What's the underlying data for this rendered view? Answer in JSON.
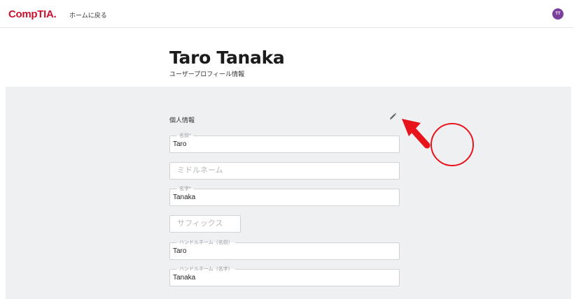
{
  "header": {
    "logo_text": "CompTIA.",
    "home_link": "ホームに戻る",
    "avatar_initials": "TT"
  },
  "profile": {
    "name": "Taro Tanaka",
    "subtitle": "ユーザープロフィール情報"
  },
  "section": {
    "title": "個人情報"
  },
  "fields": {
    "first_name": {
      "label": "名前*",
      "value": "Taro"
    },
    "middle_name": {
      "placeholder": "ミドルネーム"
    },
    "last_name": {
      "label": "名字*",
      "value": "Tanaka"
    },
    "suffix": {
      "placeholder": "サフィックス"
    },
    "handle_first": {
      "label": "ハンドルネーム（名前）",
      "value": "Taro"
    },
    "handle_last": {
      "label": "ハンドルネーム（名字）",
      "value": "Tanaka"
    }
  },
  "colors": {
    "brand": "#c8102e",
    "avatar": "#7a3e9d",
    "panel": "#eef0f1",
    "annotation": "#e8141b"
  },
  "icons": {
    "edit": "pencil-icon"
  }
}
